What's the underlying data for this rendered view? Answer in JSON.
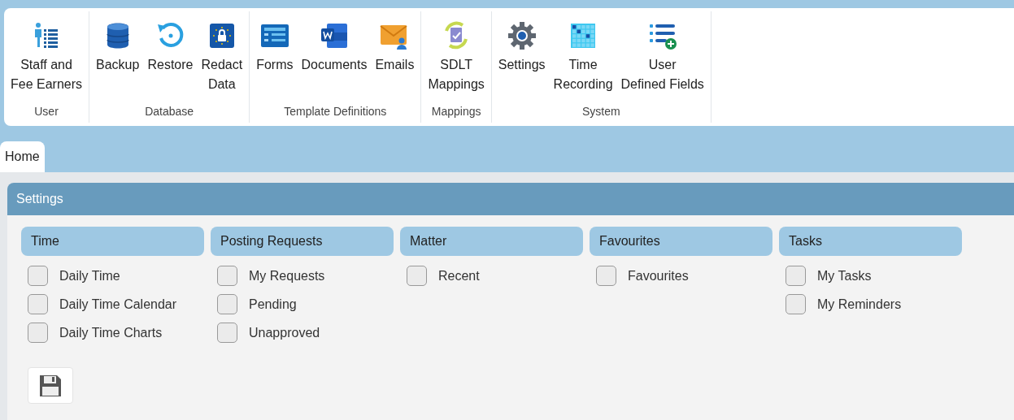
{
  "ribbon": {
    "groups": [
      {
        "label": "User",
        "buttons": [
          {
            "kind": "staff",
            "label": "Staff and\nFee Earners"
          }
        ]
      },
      {
        "label": "Database",
        "buttons": [
          {
            "kind": "database",
            "label": "Backup"
          },
          {
            "kind": "restore",
            "label": "Restore"
          },
          {
            "kind": "redact",
            "label": "Redact\nData"
          }
        ]
      },
      {
        "label": "Template Definitions",
        "buttons": [
          {
            "kind": "forms",
            "label": "Forms"
          },
          {
            "kind": "word",
            "label": "Documents"
          },
          {
            "kind": "email",
            "label": "Emails"
          }
        ]
      },
      {
        "label": "Mappings",
        "buttons": [
          {
            "kind": "mapping",
            "label": "SDLT\nMappings"
          }
        ]
      },
      {
        "label": "System",
        "buttons": [
          {
            "kind": "gear",
            "label": "Settings"
          },
          {
            "kind": "grid",
            "label": "Time\nRecording"
          },
          {
            "kind": "fields",
            "label": "User\nDefined Fields"
          }
        ]
      }
    ]
  },
  "tabs": [
    {
      "label": "Home",
      "selected": true
    }
  ],
  "settings": {
    "title": "Settings",
    "sections": [
      {
        "title": "Time",
        "options": [
          {
            "label": "Daily Time",
            "checked": false
          },
          {
            "label": "Daily Time Calendar",
            "checked": false
          },
          {
            "label": "Daily Time Charts",
            "checked": false
          }
        ]
      },
      {
        "title": "Posting Requests",
        "options": [
          {
            "label": "My Requests",
            "checked": false
          },
          {
            "label": "Pending",
            "checked": false
          },
          {
            "label": "Unapproved",
            "checked": false
          }
        ]
      },
      {
        "title": "Matter",
        "options": [
          {
            "label": "Recent",
            "checked": false
          }
        ]
      },
      {
        "title": "Favourites",
        "options": [
          {
            "label": "Favourites",
            "checked": false
          }
        ]
      },
      {
        "title": "Tasks",
        "options": [
          {
            "label": "My Tasks",
            "checked": false
          },
          {
            "label": "My Reminders",
            "checked": false
          }
        ]
      }
    ]
  }
}
